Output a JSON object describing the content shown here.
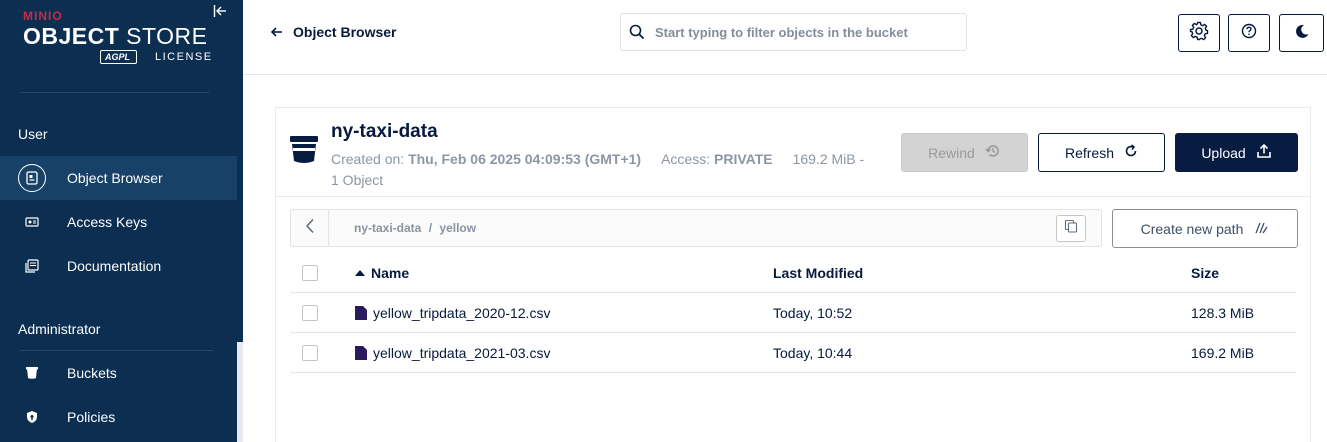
{
  "sidebar": {
    "logo": {
      "brand_prefix": "MIN",
      "brand_suffix": "IO",
      "product_bold": "OBJECT",
      "product_rest": " STORE",
      "badge": "AGPL",
      "license": "LICENSE"
    },
    "sections": [
      {
        "title": "User",
        "items": [
          {
            "label": "Object Browser",
            "icon": "object-browser-icon",
            "active": true
          },
          {
            "label": "Access Keys",
            "icon": "access-keys-icon",
            "active": false
          },
          {
            "label": "Documentation",
            "icon": "documentation-icon",
            "active": false
          }
        ]
      },
      {
        "title": "Administrator",
        "items": [
          {
            "label": "Buckets",
            "icon": "buckets-icon",
            "active": false
          },
          {
            "label": "Policies",
            "icon": "policies-icon",
            "active": false
          }
        ]
      }
    ]
  },
  "header": {
    "back_label": "Object Browser",
    "search_placeholder": "Start typing to filter objects in the bucket"
  },
  "bucket": {
    "name": "ny-taxi-data",
    "created_label": "Created on:",
    "created_value": "Thu, Feb 06 2025 04:09:53 (GMT+1)",
    "access_label": "Access:",
    "access_value": "PRIVATE",
    "usage": "169.2 MiB -",
    "object_count": "1 Object"
  },
  "actions": {
    "rewind": "Rewind",
    "refresh": "Refresh",
    "upload": "Upload",
    "new_path": "Create new path"
  },
  "path": {
    "crumbs": [
      "ny-taxi-data",
      "yellow"
    ],
    "separator": "/"
  },
  "table": {
    "columns": {
      "name": "Name",
      "modified": "Last Modified",
      "size": "Size"
    },
    "rows": [
      {
        "name": "yellow_tripdata_2020-12.csv",
        "modified": "Today, 10:52",
        "size": "128.3 MiB"
      },
      {
        "name": "yellow_tripdata_2021-03.csv",
        "modified": "Today, 10:44",
        "size": "169.2 MiB"
      }
    ]
  },
  "colors": {
    "sidebar_bg": "#0b2e51",
    "sidebar_active": "#184168",
    "primary": "#081c42",
    "brand_red": "#c72c48",
    "file_icon": "#2b1a5e"
  }
}
